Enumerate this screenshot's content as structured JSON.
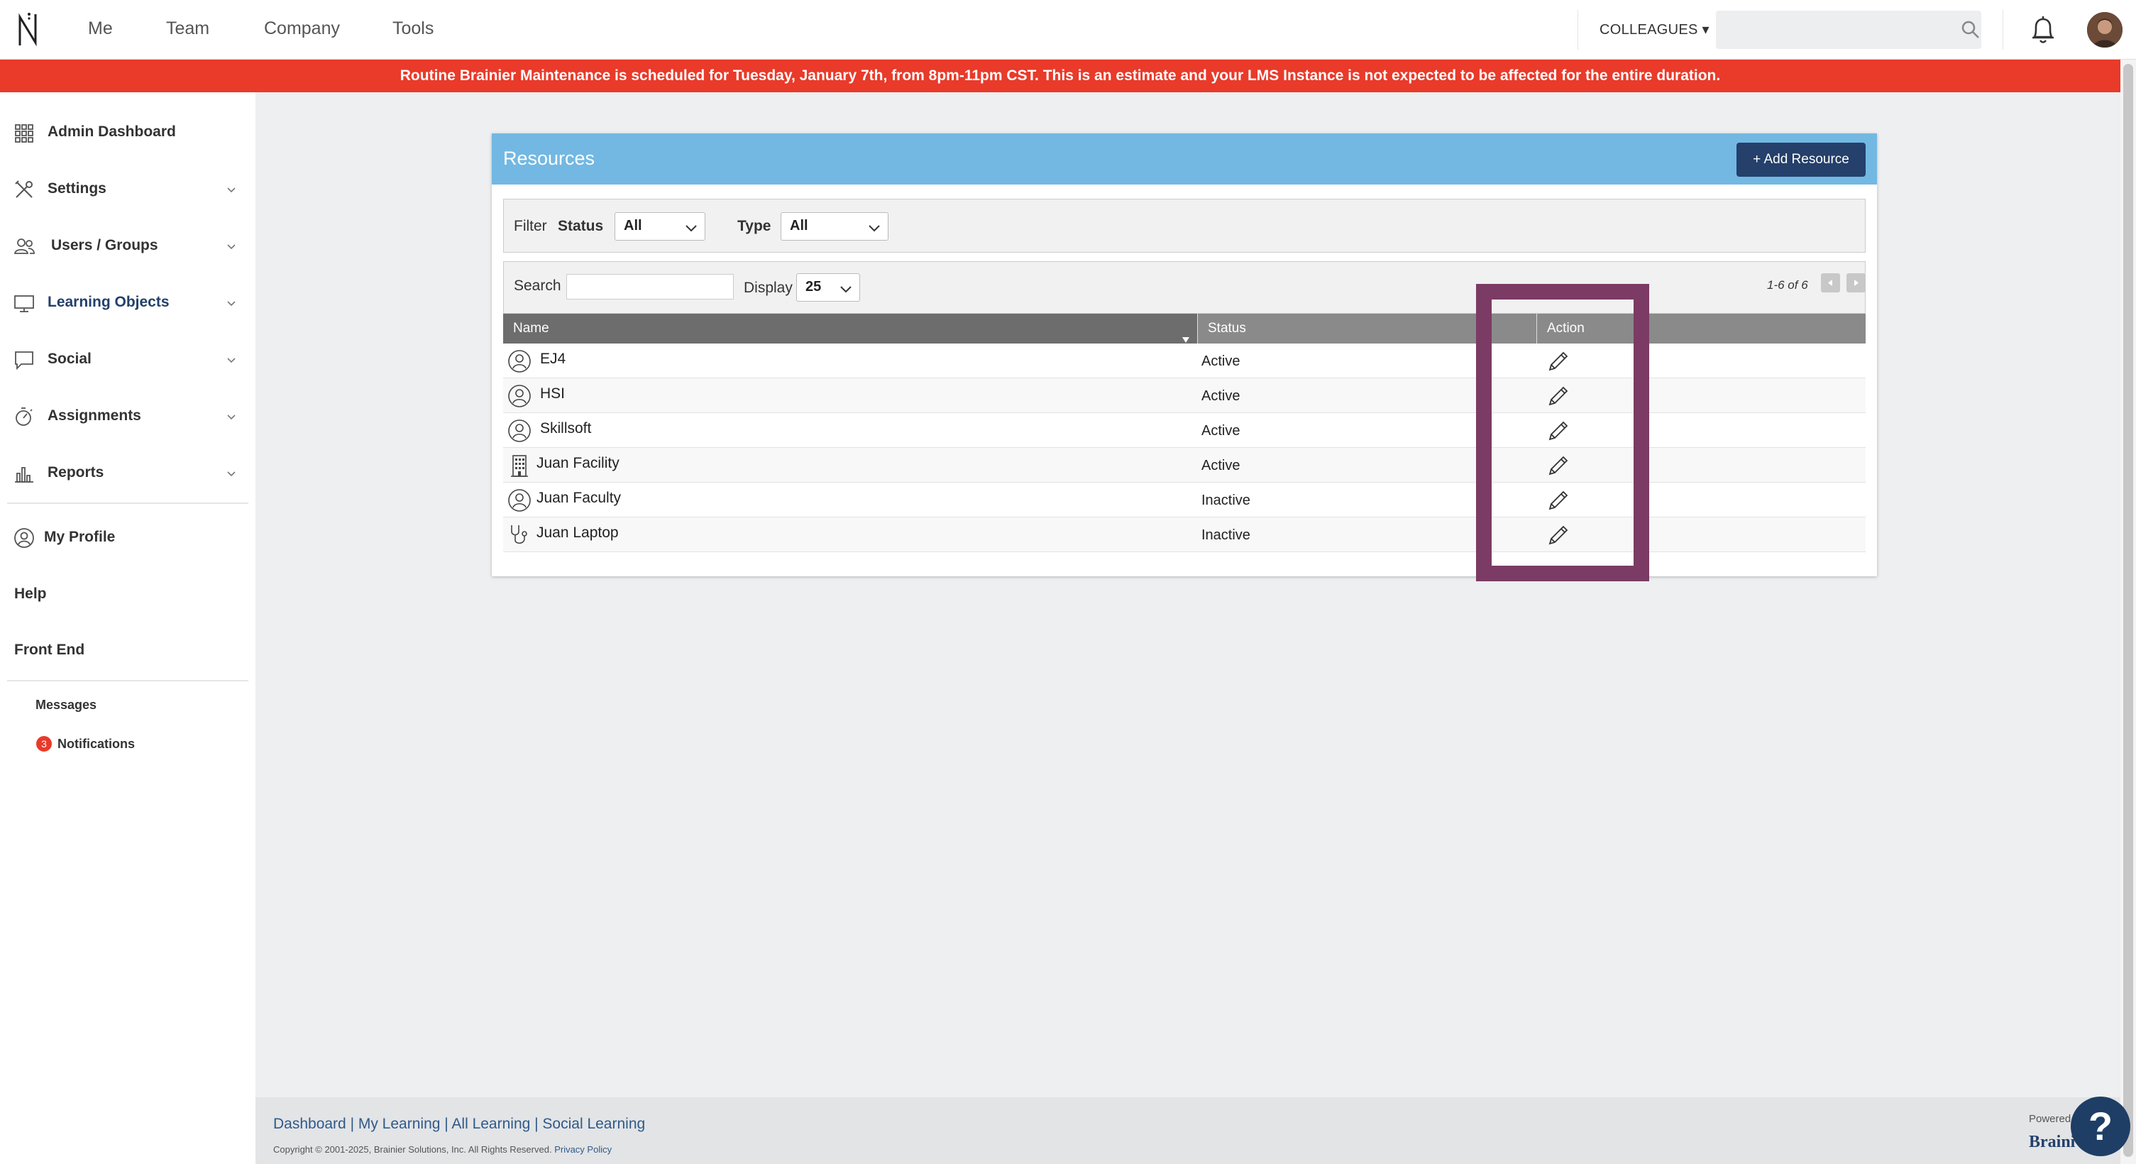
{
  "nav": {
    "me": "Me",
    "team": "Team",
    "company": "Company",
    "tools": "Tools",
    "colleagues": "COLLEAGUES ▾",
    "search_placeholder": ""
  },
  "banner": "Routine Brainier Maintenance is scheduled for Tuesday, January 7th, from 8pm-11pm CST. This is an estimate and your LMS Instance is not expected to be affected for the entire duration.",
  "sidebar": {
    "items": [
      {
        "label": "Admin Dashboard",
        "icon": "grid-icon"
      },
      {
        "label": "Settings",
        "icon": "tools-icon"
      },
      {
        "label": "Users / Groups",
        "icon": "users-icon"
      },
      {
        "label": "Learning Objects",
        "icon": "monitor-icon",
        "active_color": "#24406b"
      },
      {
        "label": "Social",
        "icon": "chat-icon"
      },
      {
        "label": "Assignments",
        "icon": "stopwatch-icon"
      },
      {
        "label": "Reports",
        "icon": "bar-chart-icon"
      }
    ],
    "my_profile": "My Profile",
    "help": "Help",
    "front_end": "Front End",
    "messages": "Messages",
    "notifications": "Notifications",
    "notifications_count": "3"
  },
  "panel": {
    "title": "Resources",
    "add_button": "+ Add Resource",
    "filter_label": "Filter",
    "status_label": "Status",
    "status_value": "All",
    "type_label": "Type",
    "type_value": "All",
    "search_label": "Search",
    "display_label": "Display",
    "display_value": "25",
    "pager": "1-6 of 6"
  },
  "table": {
    "headers": {
      "name": "Name",
      "status": "Status",
      "action": "Action"
    },
    "rows": [
      {
        "name": "EJ4",
        "status": "Active",
        "icon": "person-icon"
      },
      {
        "name": "HSI",
        "status": "Active",
        "icon": "person-icon"
      },
      {
        "name": "Skillsoft",
        "status": "Active",
        "icon": "person-icon"
      },
      {
        "name": "Juan Facility",
        "status": "Active",
        "icon": "building-icon"
      },
      {
        "name": "Juan Faculty",
        "status": "Inactive",
        "icon": "person-icon"
      },
      {
        "name": "Juan Laptop",
        "status": "Inactive",
        "icon": "stethoscope-icon"
      }
    ]
  },
  "colors": {
    "banner": "#e93a2a",
    "header": "#72b8e3",
    "button": "#24406b",
    "highlight": "#7b3b64"
  },
  "footer": {
    "links": [
      "Dashboard",
      "My Learning",
      "All Learning",
      "Social Learning"
    ],
    "separator": " | ",
    "copyright": "Copyright © 2001-2025, Brainier Solutions, Inc. All Rights Reserved.",
    "privacy": "Privacy Policy",
    "powered": "Powered",
    "brand": "Braini",
    "help_fab": "?"
  }
}
